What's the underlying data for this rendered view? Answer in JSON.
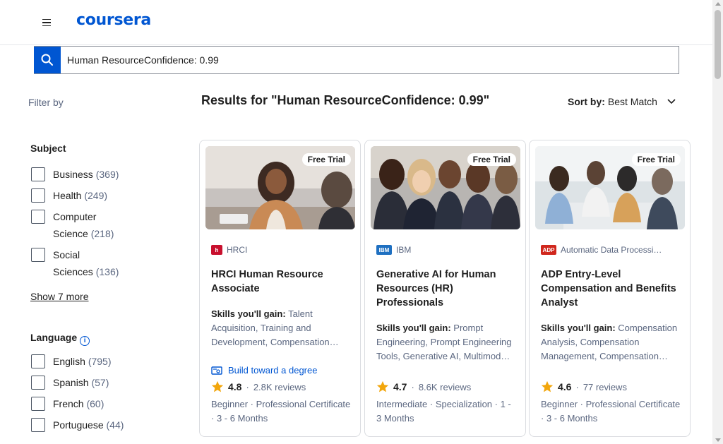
{
  "header": {
    "logo": "coursera"
  },
  "search": {
    "value": "Human ResourceConfidence: 0.99"
  },
  "filters": {
    "heading": "Filter by",
    "subject": {
      "title": "Subject",
      "options": [
        {
          "label": "Business",
          "count": "(369)"
        },
        {
          "label": "Health",
          "count": "(249)"
        },
        {
          "label": "Computer Science",
          "count": "(218)"
        },
        {
          "label": "Social Sciences",
          "count": "(136)"
        }
      ],
      "show_more": "Show 7 more"
    },
    "language": {
      "title": "Language",
      "options": [
        {
          "label": "English",
          "count": "(795)"
        },
        {
          "label": "Spanish",
          "count": "(57)"
        },
        {
          "label": "French",
          "count": "(60)"
        },
        {
          "label": "Portuguese",
          "count": "(44)"
        }
      ]
    }
  },
  "results": {
    "title": "Results for \"Human ResourceConfidence: 0.99\"",
    "sort_label": "Sort by:",
    "sort_value": "Best Match"
  },
  "cards": [
    {
      "badge": "Free Trial",
      "partner": "HRCI",
      "partner_logo": "h",
      "partner_color": "#c8102e",
      "title": "HRCI Human Resource Associate",
      "skills_label": "Skills you'll gain:",
      "skills": "Talent Acquisition, Training and Development, Compensation…",
      "degree": "Build toward a degree",
      "rating": "4.8",
      "reviews": "2.8K reviews",
      "meta": "Beginner · Professional Certificate · 3 - 6 Months"
    },
    {
      "badge": "Free Trial",
      "partner": "IBM",
      "partner_logo": "IBM",
      "partner_color": "#1f70c1",
      "title": "Generative AI for Human Resources (HR) Professionals",
      "skills_label": "Skills you'll gain:",
      "skills": "Prompt Engineering, Prompt Engineering Tools, Generative AI, Multimod…",
      "degree": "",
      "rating": "4.7",
      "reviews": "8.6K reviews",
      "meta": "Intermediate · Specialization · 1 - 3 Months"
    },
    {
      "badge": "Free Trial",
      "partner": "Automatic Data Processi…",
      "partner_logo": "ADP",
      "partner_color": "#d0271d",
      "title": "ADP Entry-Level Compensation and Benefits Analyst",
      "skills_label": "Skills you'll gain:",
      "skills": "Compensation Analysis, Compensation Management, Compensation…",
      "degree": "",
      "rating": "4.6",
      "reviews": "77 reviews",
      "meta": "Beginner · Professional Certificate · 3 - 6 Months"
    }
  ],
  "colors": {
    "brand": "#0056d2",
    "star": "#f2a60c"
  }
}
